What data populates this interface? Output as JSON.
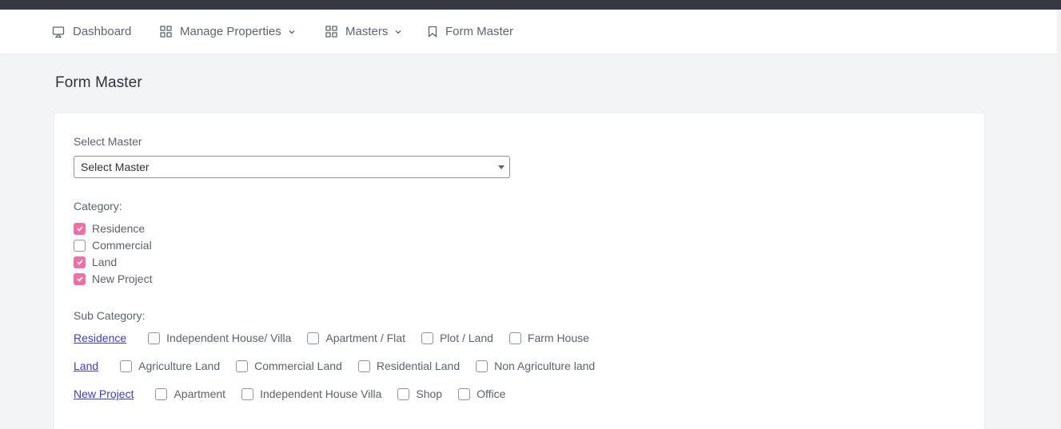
{
  "nav": {
    "dashboard": "Dashboard",
    "manage_properties": "Manage Properties",
    "masters": "Masters",
    "form_master": "Form Master"
  },
  "page": {
    "title": "Form Master"
  },
  "form": {
    "select_master_label": "Select Master",
    "select_master_value": "Select Master",
    "category_label": "Category:",
    "categories": [
      {
        "label": "Residence",
        "checked": true
      },
      {
        "label": "Commercial",
        "checked": false
      },
      {
        "label": "Land",
        "checked": true
      },
      {
        "label": "New Project",
        "checked": true
      }
    ],
    "subcategory_label": "Sub Category:",
    "subcategories": [
      {
        "group": "Residence",
        "options": [
          "Independent House/ Villa",
          "Apartment / Flat",
          "Plot / Land",
          "Farm House"
        ]
      },
      {
        "group": "Land",
        "options": [
          "Agriculture Land",
          "Commercial Land",
          "Residential Land",
          "Non Agriculture land"
        ]
      },
      {
        "group": "New Project",
        "options": [
          "Apartment",
          "Independent House Villa",
          "Shop",
          "Office"
        ]
      }
    ]
  },
  "colors": {
    "accent": "#ef6fa6",
    "link": "#3e3fbf",
    "topbar": "#353a42"
  }
}
